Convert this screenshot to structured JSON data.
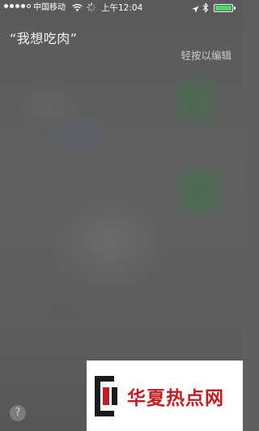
{
  "status_bar": {
    "carrier": "中国移动",
    "time": "上午12:04",
    "signal_bars_filled": 4,
    "signal_bars_total": 5,
    "battery_level": 1.0,
    "battery_color": "#4cd964",
    "icons": [
      "wifi-icon",
      "activity-spinner-icon",
      "location-arrow-icon",
      "bluetooth-icon",
      "battery-icon"
    ]
  },
  "siri": {
    "query": "“我想吃肉”",
    "edit_hint": "轻按以编辑",
    "help_label": "?"
  },
  "watermark": {
    "text": "华夏热点网",
    "color": "#c21d23"
  }
}
